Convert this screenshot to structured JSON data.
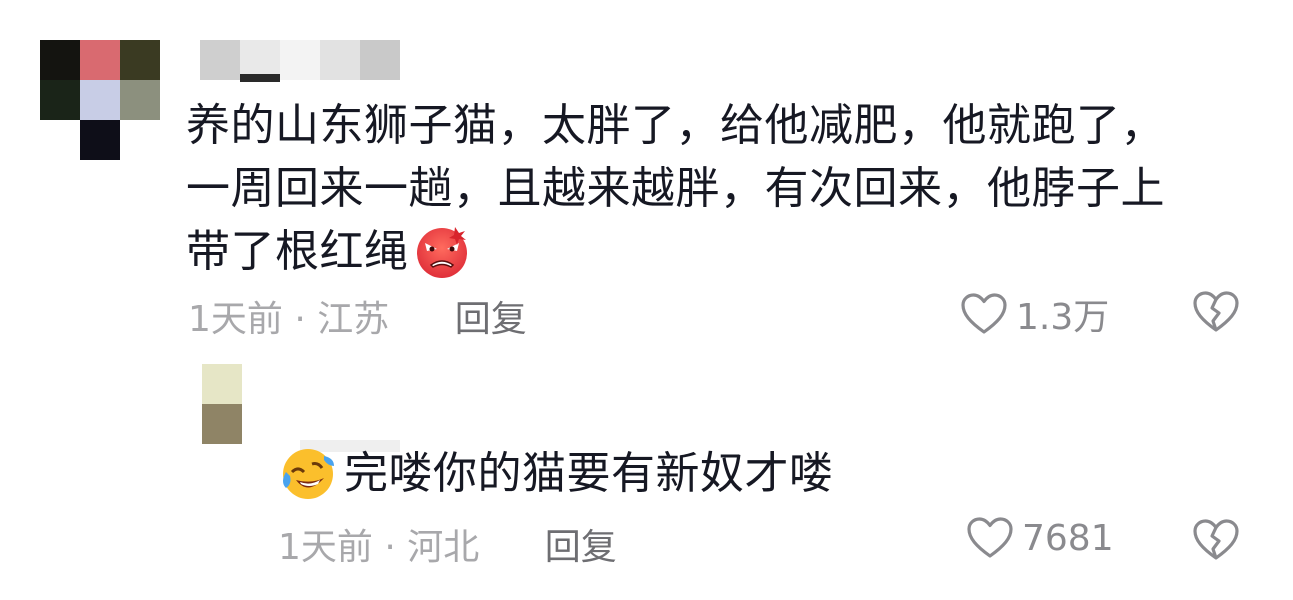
{
  "comment": {
    "lines": [
      "养的山东狮子猫，太胖了，给他减肥，他就跑了，",
      "一周回来一趟，且越来越胖，有次回来，他脖子上",
      "带了根红绳"
    ],
    "emoji": "angry-face",
    "time": "1天前",
    "separator": "·",
    "location": "江苏",
    "reply_label": "回复",
    "likes": "1.3万"
  },
  "reply": {
    "emoji": "rolling-laughing-face",
    "text": "完喽你的猫要有新奴才喽",
    "time": "1天前",
    "separator": "·",
    "location": "河北",
    "reply_label": "回复",
    "likes": "7681"
  },
  "colors": {
    "text": "#161823",
    "meta": "#a8a8ab",
    "reply_button": "#6e6e72",
    "icon": "#8a8a8e"
  }
}
